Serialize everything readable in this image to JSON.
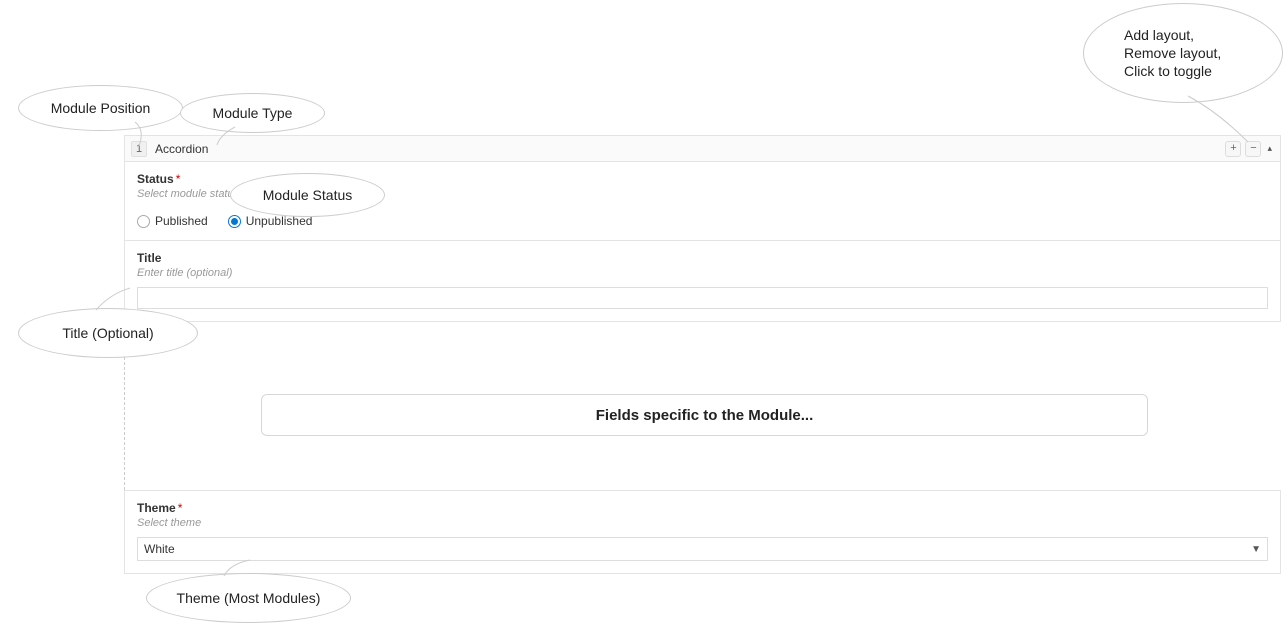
{
  "header": {
    "position_index": "1",
    "module_type": "Accordion",
    "plus_icon": "+",
    "minus_icon": "−",
    "collapse_icon": "▴"
  },
  "status": {
    "label": "Status",
    "required": "*",
    "help": "Select module status",
    "options": {
      "published": "Published",
      "unpublished": "Unpublished"
    },
    "selected": "unpublished"
  },
  "title": {
    "label": "Title",
    "help": "Enter title (optional)",
    "value": ""
  },
  "placeholder_panel": "Fields specific to the Module...",
  "theme": {
    "label": "Theme",
    "required": "*",
    "help": "Select theme",
    "value": "White"
  },
  "callouts": {
    "module_position": "Module Position",
    "module_type": "Module Type",
    "module_status": "Module Status",
    "title_optional": "Title (Optional)",
    "theme_note": "Theme (Most Modules)",
    "toggle_note_line1": "Add layout,",
    "toggle_note_line2": "Remove layout,",
    "toggle_note_line3": "Click to toggle"
  }
}
